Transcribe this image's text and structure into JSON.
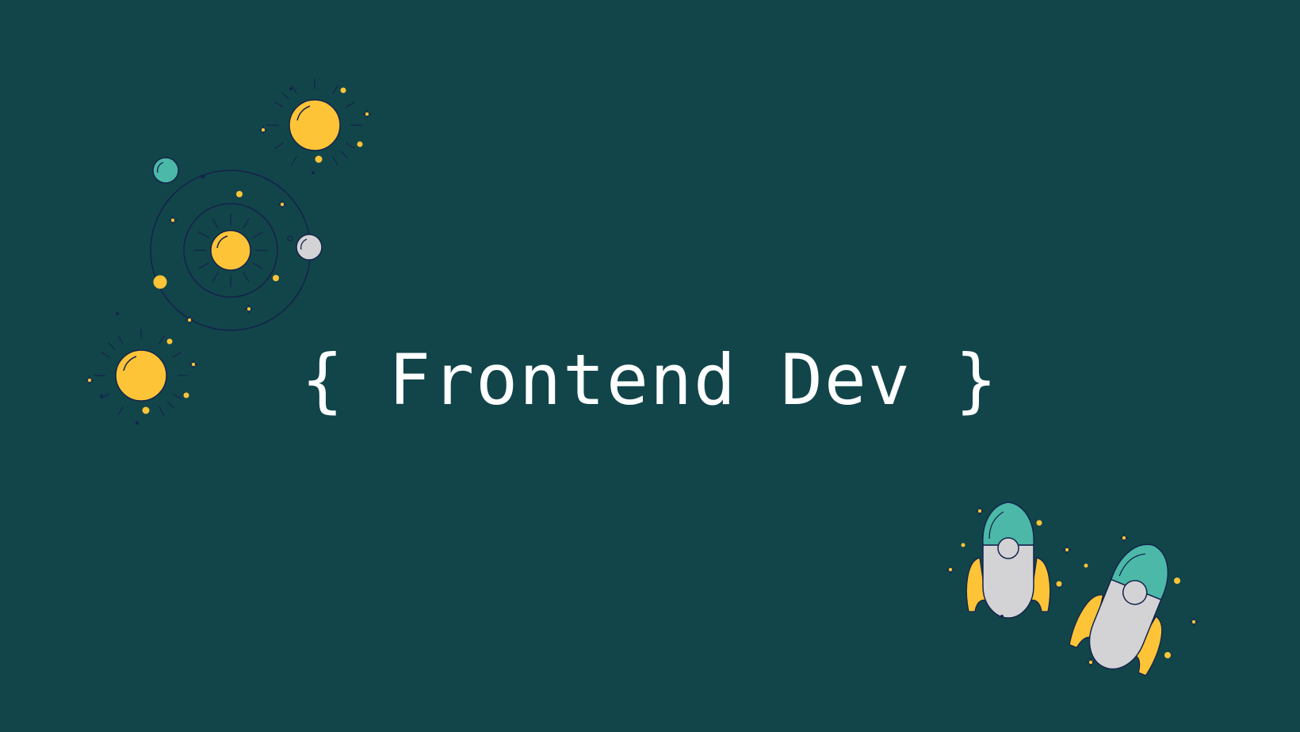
{
  "title": "{ Frontend Dev }",
  "colors": {
    "background": "#11454a",
    "sun": "#fdc438",
    "planet_teal": "#4bb8a8",
    "planet_grey": "#d3d3d6",
    "outline": "#15234a",
    "text": "#ffffff"
  },
  "decorations": {
    "top_left": [
      "sun-icon",
      "sun-icon",
      "solar-system-icon",
      "planet-icon",
      "star-icon"
    ],
    "bottom_right": [
      "rocket-icon",
      "rocket-icon",
      "star-icon"
    ]
  }
}
